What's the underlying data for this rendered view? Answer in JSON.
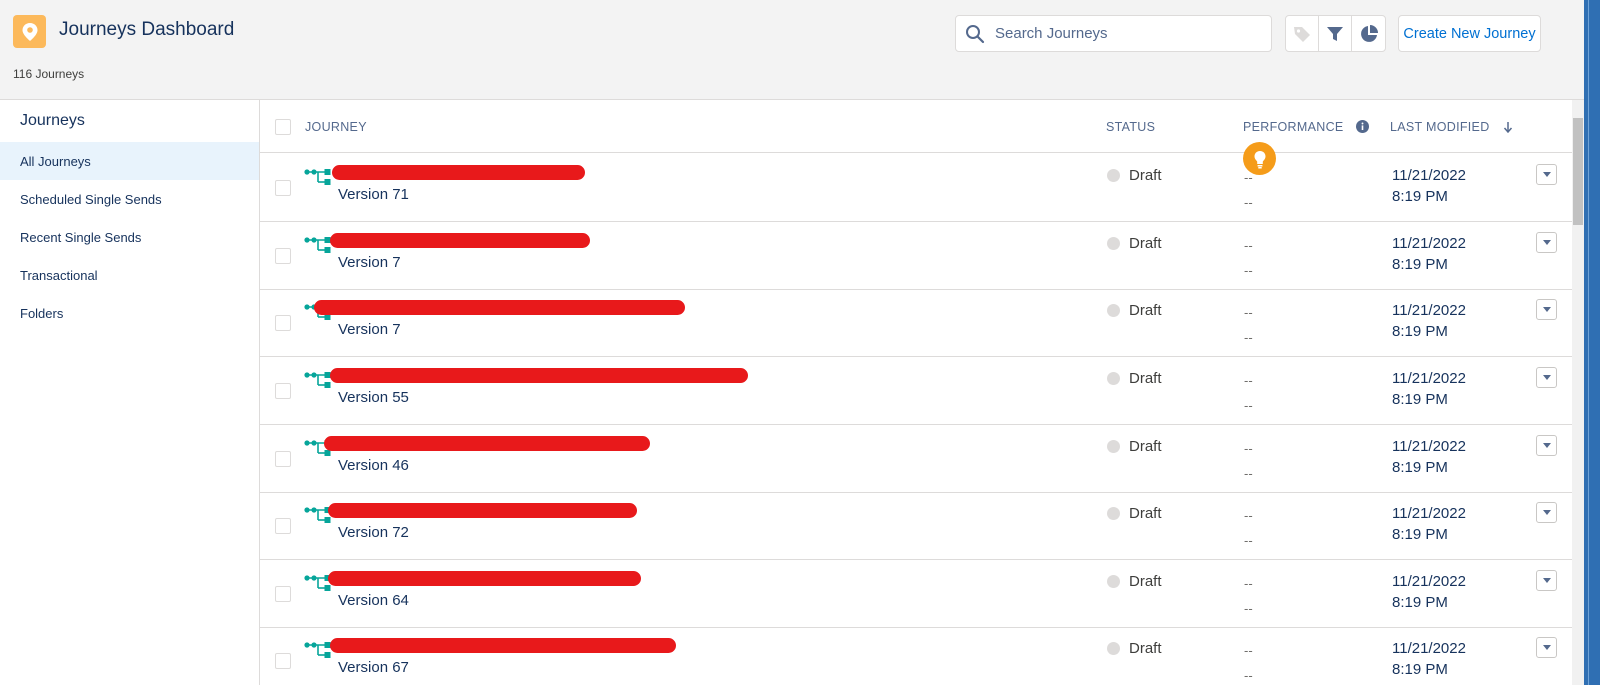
{
  "header": {
    "title": "Journeys Dashboard",
    "count": "116 Journeys",
    "search_placeholder": "Search Journeys",
    "create_label": "Create New Journey"
  },
  "sidebar": {
    "heading": "Journeys",
    "items": [
      {
        "label": "All Journeys",
        "active": true
      },
      {
        "label": "Scheduled Single Sends",
        "active": false
      },
      {
        "label": "Recent Single Sends",
        "active": false
      },
      {
        "label": "Transactional",
        "active": false
      },
      {
        "label": "Folders",
        "active": false
      }
    ]
  },
  "table": {
    "columns": {
      "journey": "JOURNEY",
      "status": "STATUS",
      "performance": "PERFORMANCE",
      "last_modified": "LAST MODIFIED"
    },
    "rows": [
      {
        "version": "Version 71",
        "status": "Draft",
        "perf1": "--",
        "perf2": "--",
        "date": "11/21/2022",
        "time": "8:19 PM"
      },
      {
        "version": "Version 7",
        "status": "Draft",
        "perf1": "--",
        "perf2": "--",
        "date": "11/21/2022",
        "time": "8:19 PM"
      },
      {
        "version": "Version 7",
        "status": "Draft",
        "perf1": "--",
        "perf2": "--",
        "date": "11/21/2022",
        "time": "8:19 PM"
      },
      {
        "version": "Version 55",
        "status": "Draft",
        "perf1": "--",
        "perf2": "--",
        "date": "11/21/2022",
        "time": "8:19 PM"
      },
      {
        "version": "Version 46",
        "status": "Draft",
        "perf1": "--",
        "perf2": "--",
        "date": "11/21/2022",
        "time": "8:19 PM"
      },
      {
        "version": "Version 72",
        "status": "Draft",
        "perf1": "--",
        "perf2": "--",
        "date": "11/21/2022",
        "time": "8:19 PM"
      },
      {
        "version": "Version 64",
        "status": "Draft",
        "perf1": "--",
        "perf2": "--",
        "date": "11/21/2022",
        "time": "8:19 PM"
      },
      {
        "version": "Version 67",
        "status": "Draft",
        "perf1": "--",
        "perf2": "--",
        "date": "11/21/2022",
        "time": "8:19 PM"
      }
    ]
  },
  "icons": {
    "app": "map-pin-icon",
    "search": "search-icon",
    "tag": "tag-icon",
    "filter": "filter-icon",
    "chart": "pie-chart-icon",
    "info": "info-icon",
    "sort": "arrow-down-icon",
    "journey": "journey-flow-icon",
    "bulb": "lightbulb-icon",
    "menu": "chevron-down-icon"
  },
  "colors": {
    "accent": "#0070d2",
    "app_icon": "#fcb95b",
    "journey_icon": "#06a59a",
    "redaction": "#e8191b",
    "bulb": "#f59c1a"
  }
}
